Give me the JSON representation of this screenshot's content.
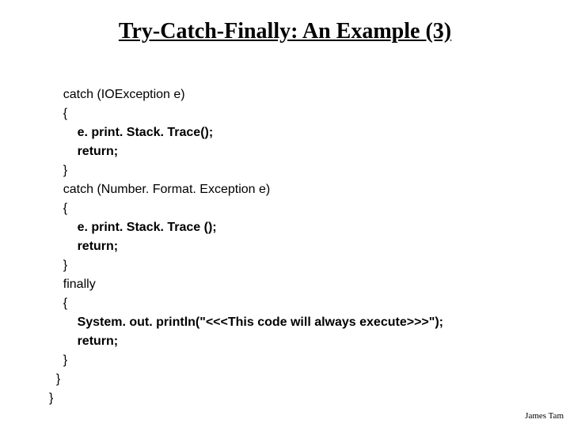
{
  "title": "Try-Catch-Finally: An Example (3)",
  "code": {
    "l01": "    catch (IOException e)",
    "l02": "    {",
    "l03": "        e. print. Stack. Trace();",
    "l04": "        return;",
    "l05": "    }",
    "l06": "    catch (Number. Format. Exception e)",
    "l07": "    {",
    "l08": "        e. print. Stack. Trace ();",
    "l09": "        return;",
    "l10": "    }",
    "l11": "    finally",
    "l12": "    {",
    "l13": "        System. out. println(\"<<<This code will always execute>>>\");",
    "l14": "        return;",
    "l15": "    }",
    "l16": "  }",
    "l17": "}"
  },
  "footer": "James Tam"
}
